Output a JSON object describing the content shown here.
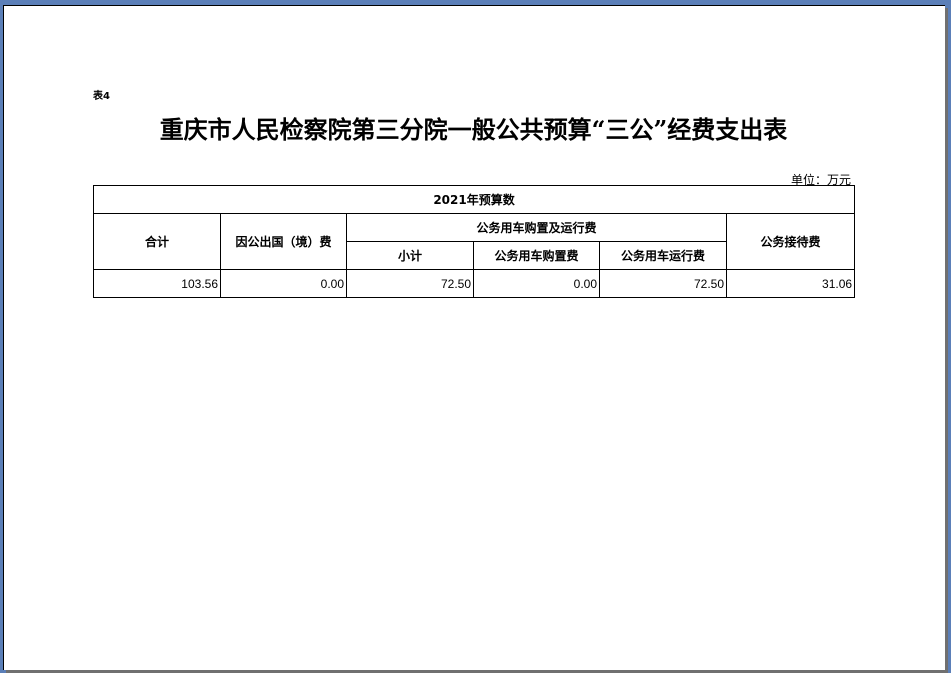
{
  "document": {
    "table_no": "表4",
    "title": "重庆市人民检察院第三分院一般公共预算“三公”经费支出表",
    "unit": "单位：万元"
  },
  "table": {
    "group_header": "2021年预算数",
    "headers": {
      "total": "合计",
      "abroad": "因公出国（境）费",
      "vehicle_group": "公务用车购置及运行费",
      "vehicle_subtotal": "小计",
      "vehicle_purchase": "公务用车购置费",
      "vehicle_operation": "公务用车运行费",
      "reception": "公务接待费"
    },
    "row": {
      "total": "103.56",
      "abroad": "0.00",
      "vehicle_subtotal": "72.50",
      "vehicle_purchase": "0.00",
      "vehicle_operation": "72.50",
      "reception": "31.06"
    }
  }
}
